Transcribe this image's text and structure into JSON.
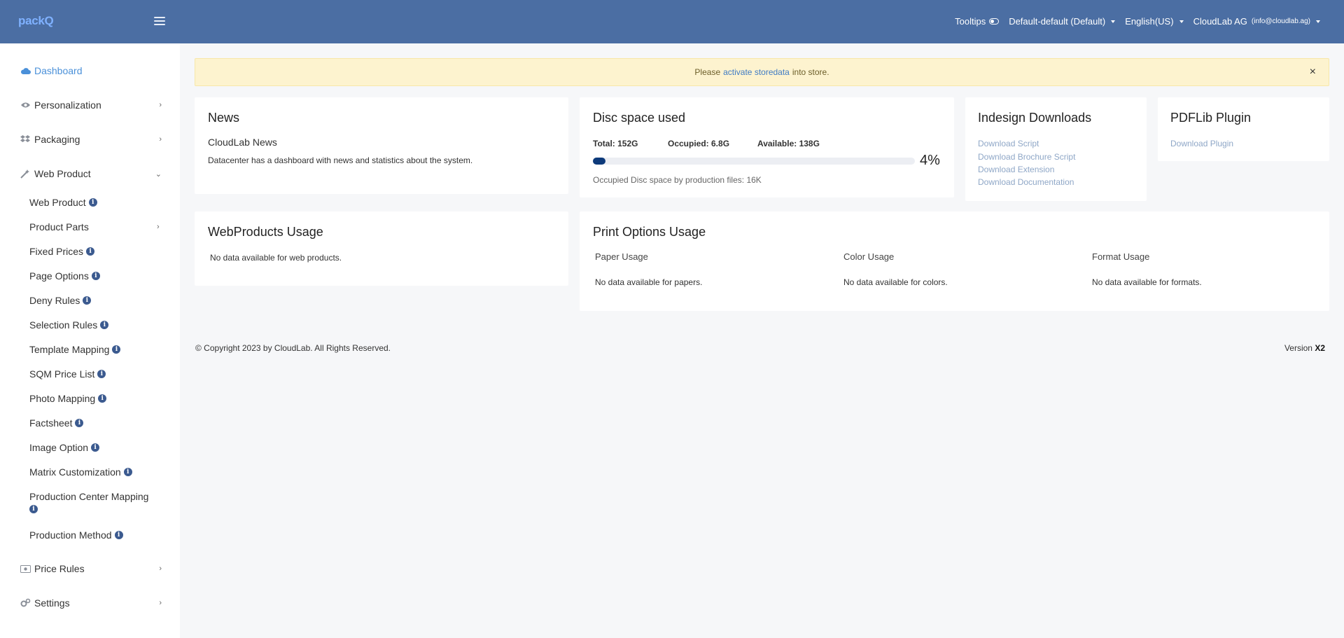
{
  "header": {
    "logo": "packQ",
    "tooltips_label": "Tooltips",
    "profile_select": "Default-default (Default)",
    "language_select": "English(US)",
    "account_name": "CloudLab AG",
    "account_email": "(info@cloudlab.ag)",
    "colors": {
      "topbar": "#4b6ea3",
      "accent": "#4a90d9"
    }
  },
  "sidebar": {
    "items": [
      {
        "label": "Dashboard",
        "icon": "cloud-icon",
        "active": true
      },
      {
        "label": "Personalization",
        "icon": "eye-icon"
      },
      {
        "label": "Packaging",
        "icon": "dropbox-icon"
      },
      {
        "label": "Web Product",
        "icon": "magic-wand-icon",
        "expanded": true
      },
      {
        "label": "Price Rules",
        "icon": "money-bill-icon"
      },
      {
        "label": "Settings",
        "icon": "cogs-icon"
      }
    ],
    "web_product_children": [
      "Web Product",
      "Product Parts",
      "Fixed Prices",
      "Page Options",
      "Deny Rules",
      "Selection Rules",
      "Template Mapping",
      "SQM Price List",
      "Photo Mapping",
      "Factsheet",
      "Image Option",
      "Matrix Customization",
      "Production Center Mapping",
      "Production Method"
    ]
  },
  "alert": {
    "prefix": "Please",
    "link": "activate storedata",
    "suffix": "into store.",
    "close": "×"
  },
  "news": {
    "title": "News",
    "subtitle": "CloudLab News",
    "text": "Datacenter has a dashboard with news and statistics about the system."
  },
  "disc": {
    "title": "Disc space used",
    "total": "Total: 152G",
    "occupied": "Occupied: 6.8G",
    "available": "Available: 138G",
    "percent_label": "4%",
    "percent_value": 4,
    "note": "Occupied Disc space by production files: 16K"
  },
  "indesign": {
    "title": "Indesign Downloads",
    "links": [
      "Download Script",
      "Download Brochure Script",
      "Download Extension",
      "Download Documentation"
    ]
  },
  "pdflib": {
    "title": "PDFLib Plugin",
    "link": "Download Plugin"
  },
  "webproducts_usage": {
    "title": "WebProducts Usage",
    "text": "No data available for web products."
  },
  "print_options": {
    "title": "Print Options Usage",
    "paper_head": "Paper Usage",
    "paper_text": "No data available for papers.",
    "color_head": "Color Usage",
    "color_text": "No data available for colors.",
    "format_head": "Format Usage",
    "format_text": "No data available for formats."
  },
  "footer": {
    "copyright": "© Copyright 2023 by CloudLab. All Rights Reserved.",
    "version_label": "Version",
    "version_value": "X2"
  }
}
